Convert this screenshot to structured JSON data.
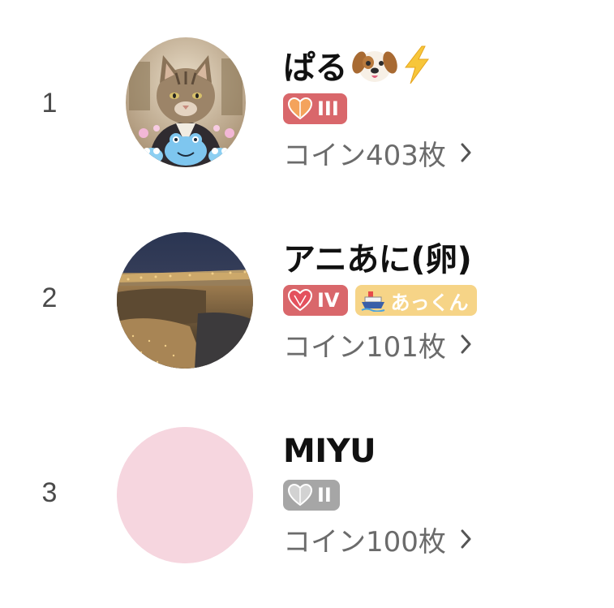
{
  "ranking": [
    {
      "rank": "1",
      "name": "ぱる",
      "name_emojis": [
        "dog-face-icon",
        "lightning-icon"
      ],
      "badges": [
        {
          "level": "III",
          "style": "red",
          "icon": "heart-icon"
        }
      ],
      "coins": "コイン403枚",
      "avatar": "cat-avatar"
    },
    {
      "rank": "2",
      "name": "アニあに(卵)",
      "name_emojis": [],
      "badges": [
        {
          "level": "IV",
          "style": "red",
          "icon": "heart-icon"
        },
        {
          "level": "あっくん",
          "style": "yellow",
          "icon": "ship-icon"
        }
      ],
      "coins": "コイン101枚",
      "avatar": "night-city-avatar"
    },
    {
      "rank": "3",
      "name": "MIYU",
      "name_emojis": [],
      "badges": [
        {
          "level": "II",
          "style": "gray",
          "icon": "heart-icon"
        }
      ],
      "coins": "コイン100枚",
      "avatar": "default-pink-avatar"
    }
  ],
  "colors": {
    "badge_red": "#d9676b",
    "badge_gray": "#a6a6a6",
    "badge_yellow": "#f6d487",
    "avatar_pink": "#f6d6df",
    "rank_text": "#4a4a4a",
    "coin_text": "#6b6b6b"
  }
}
